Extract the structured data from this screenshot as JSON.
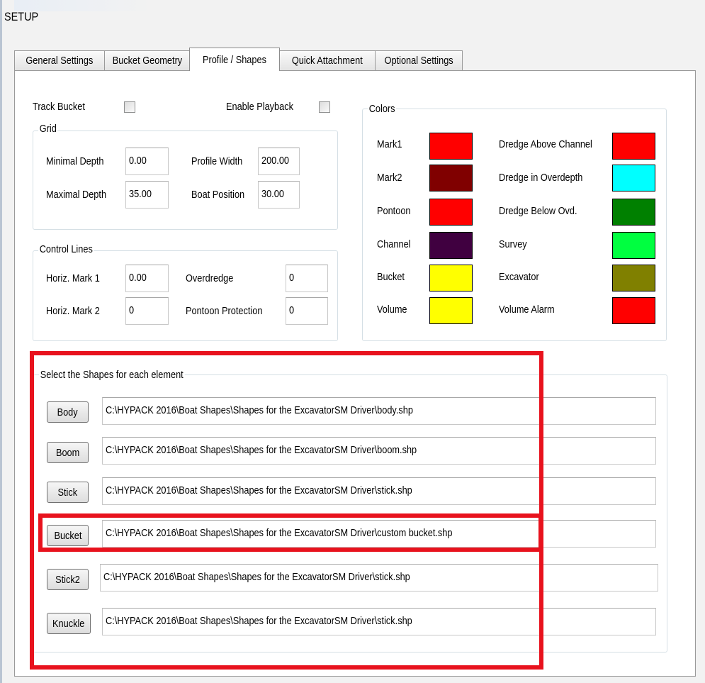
{
  "window": {
    "title": "SETUP"
  },
  "tabs": [
    {
      "label": "General Settings"
    },
    {
      "label": "Bucket Geometry"
    },
    {
      "label": "Profile / Shapes"
    },
    {
      "label": "Quick Attachment"
    },
    {
      "label": "Optional Settings"
    }
  ],
  "active_tab": "Profile / Shapes",
  "options": {
    "track_bucket": {
      "label": "Track Bucket",
      "checked": false
    },
    "enable_playback": {
      "label": "Enable Playback",
      "checked": false
    }
  },
  "grid": {
    "legend": "Grid",
    "minimal_depth": {
      "label": "Minimal Depth",
      "value": "0.00"
    },
    "maximal_depth": {
      "label": "Maximal Depth",
      "value": "35.00"
    },
    "profile_width": {
      "label": "Profile Width",
      "value": "200.00"
    },
    "boat_position": {
      "label": "Boat Position",
      "value": "30.00"
    }
  },
  "control_lines": {
    "legend": "Control Lines",
    "horiz_mark_1": {
      "label": "Horiz. Mark 1",
      "value": "0.00"
    },
    "horiz_mark_2": {
      "label": "Horiz. Mark 2",
      "value": "0"
    },
    "overdredge": {
      "label": "Overdredge",
      "value": "0"
    },
    "pontoon_protection": {
      "label": "Pontoon Protection",
      "value": "0"
    }
  },
  "colors": {
    "legend": "Colors",
    "left": [
      {
        "label": "Mark1",
        "color": "#ff0000"
      },
      {
        "label": "Mark2",
        "color": "#800000"
      },
      {
        "label": "Pontoon",
        "color": "#ff0000"
      },
      {
        "label": "Channel",
        "color": "#400040"
      },
      {
        "label": "Bucket",
        "color": "#ffff00"
      },
      {
        "label": "Volume",
        "color": "#ffff00"
      }
    ],
    "right": [
      {
        "label": "Dredge Above Channel",
        "color": "#ff0000"
      },
      {
        "label": "Dredge in Overdepth",
        "color": "#00ffff"
      },
      {
        "label": "Dredge Below Ovd.",
        "color": "#008000"
      },
      {
        "label": "Survey",
        "color": "#00ff40"
      },
      {
        "label": "Excavator",
        "color": "#808000"
      },
      {
        "label": "Volume Alarm",
        "color": "#ff0000"
      }
    ]
  },
  "shapes": {
    "legend": "Select the Shapes for each element",
    "items": [
      {
        "button": "Body",
        "path": "C:\\HYPACK 2016\\Boat Shapes\\Shapes for the ExcavatorSM Driver\\body.shp"
      },
      {
        "button": "Boom",
        "path": "C:\\HYPACK 2016\\Boat Shapes\\Shapes for the ExcavatorSM Driver\\boom.shp"
      },
      {
        "button": "Stick",
        "path": "C:\\HYPACK 2016\\Boat Shapes\\Shapes for the ExcavatorSM Driver\\stick.shp"
      },
      {
        "button": "Bucket",
        "path": "C:\\HYPACK 2016\\Boat Shapes\\Shapes for the ExcavatorSM Driver\\custom bucket.shp"
      },
      {
        "button": "Stick2",
        "path": "C:\\HYPACK 2016\\Boat Shapes\\Shapes for the ExcavatorSM Driver\\stick.shp"
      },
      {
        "button": "Knuckle",
        "path": "C:\\HYPACK 2016\\Boat Shapes\\Shapes for the ExcavatorSM Driver\\stick.shp"
      }
    ]
  },
  "annotation": {
    "highlight_color": "#e8121d"
  }
}
